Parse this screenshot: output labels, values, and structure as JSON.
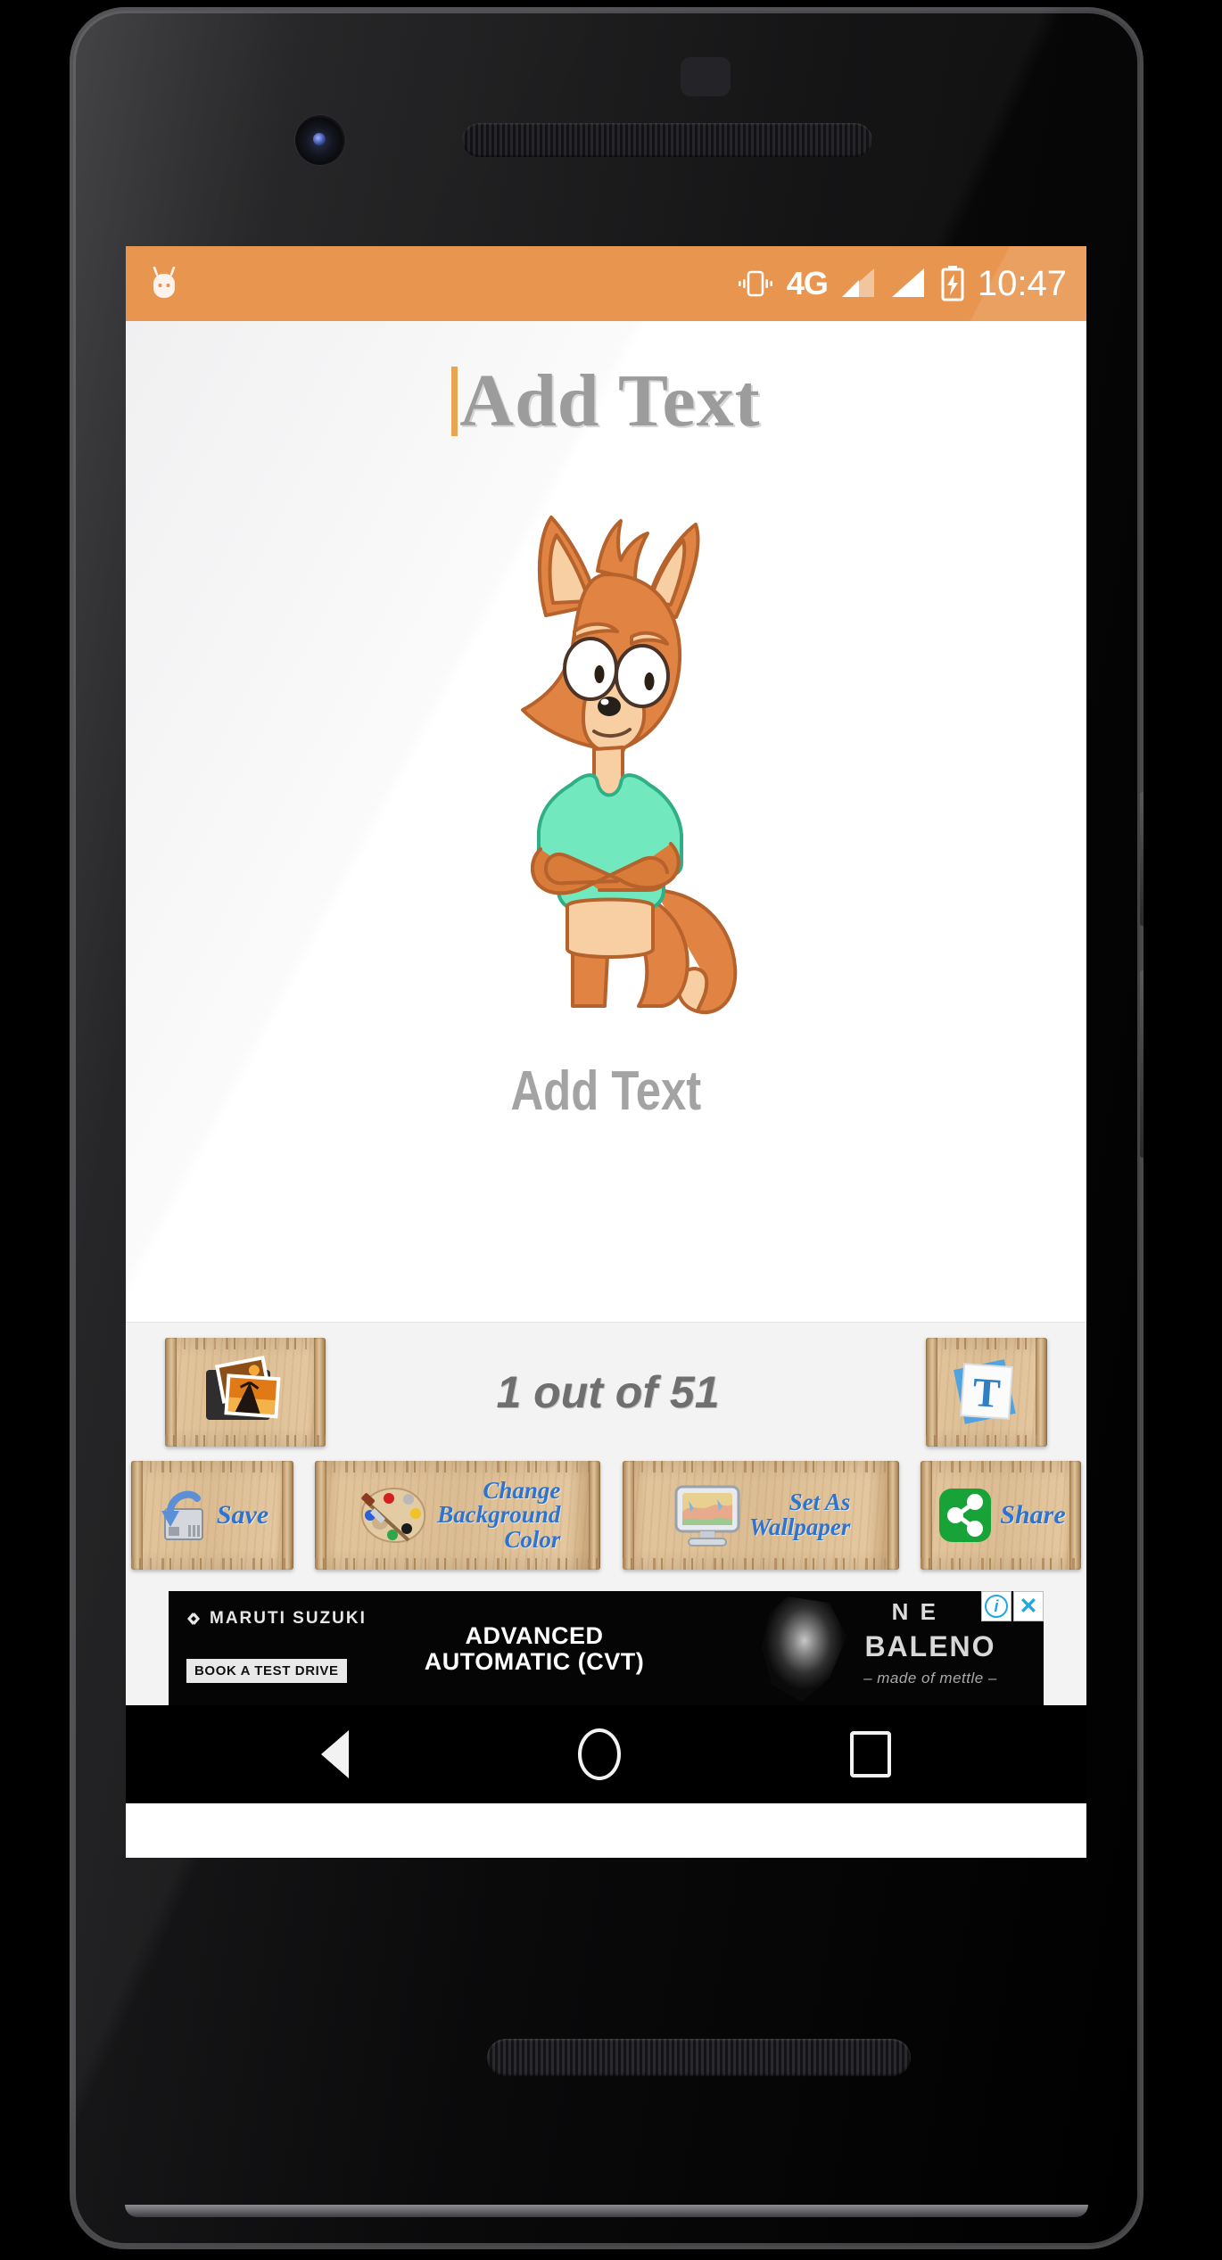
{
  "status_bar": {
    "background_color": "#e8954f",
    "vibrate_icon": "vibrate-icon",
    "network_type": "4G",
    "signal_icon_1": "signal-bars-partial-icon",
    "signal_icon_2": "signal-bars-full-icon",
    "battery_icon": "battery-charging-icon",
    "time": "10:47",
    "android_icon": "android-marshmallow-icon"
  },
  "canvas": {
    "top_text": "Add Text",
    "top_text_color": "#9c9c9c",
    "caret_color": "#e8a552",
    "sticker_name": "fox-character-sticker",
    "bottom_text": "Add Text",
    "bottom_text_color": "#a3a3a3"
  },
  "toolbar": {
    "gallery_button_label": "gallery-icon",
    "counter_text": "1 out of 51",
    "text_button_label": "text-tool-icon",
    "actions": [
      {
        "label": "Save",
        "icon": "save-disk-icon",
        "name": "save-button"
      },
      {
        "label": "Change\nBackground\nColor",
        "icon": "palette-icon",
        "name": "change-background-color-button"
      },
      {
        "label": "Set As\nWallpaper",
        "icon": "monitor-icon",
        "name": "set-as-wallpaper-button"
      },
      {
        "label": "Share",
        "icon": "share-icon",
        "name": "share-button"
      }
    ],
    "label_color": "#2c73d2",
    "scroll_color": "#dcbd93"
  },
  "ad": {
    "brand": "MARUTI SUZUKI",
    "headline": "ADVANCED\nAUTOMATIC (CVT)",
    "cta": "BOOK A TEST DRIVE",
    "new_label": "N E",
    "model": "BALENO",
    "tagline": "– made of mettle –",
    "info_icon": "ad-info-icon",
    "close_icon": "ad-close-icon"
  },
  "navbar": {
    "back": "back-icon",
    "home": "home-icon",
    "recents": "recents-icon"
  }
}
